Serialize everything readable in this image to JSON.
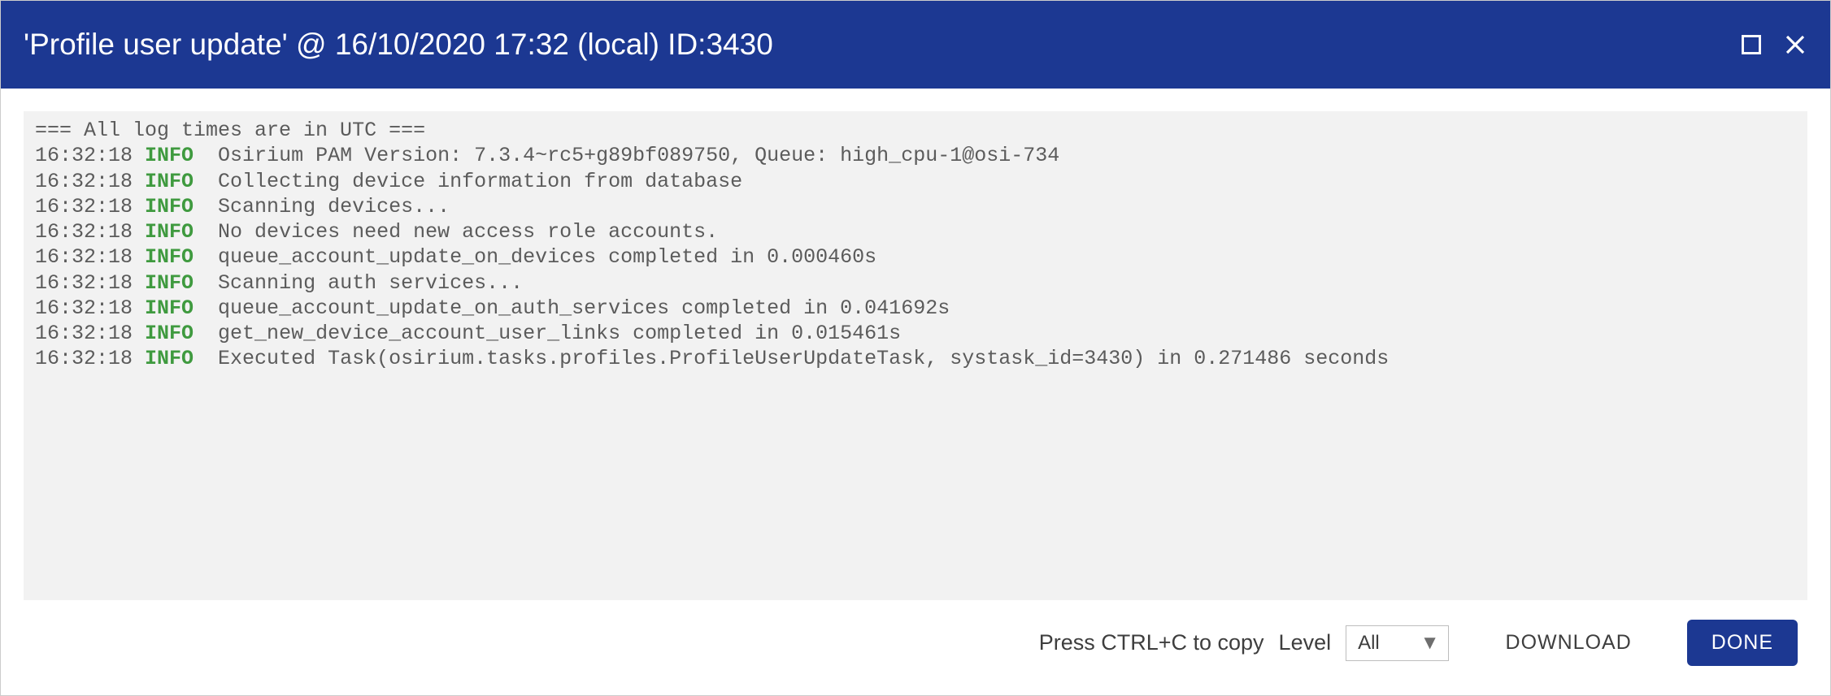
{
  "titlebar": {
    "title": "'Profile user update' @ 16/10/2020 17:32 (local) ID:3430"
  },
  "log": {
    "header": "=== All log times are in UTC ===",
    "lines": [
      {
        "time": "16:32:18",
        "level": "INFO",
        "msg": "Osirium PAM Version: 7.3.4~rc5+g89bf089750, Queue: high_cpu-1@osi-734"
      },
      {
        "time": "16:32:18",
        "level": "INFO",
        "msg": "Collecting device information from database"
      },
      {
        "time": "16:32:18",
        "level": "INFO",
        "msg": "Scanning devices..."
      },
      {
        "time": "16:32:18",
        "level": "INFO",
        "msg": "No devices need new access role accounts."
      },
      {
        "time": "16:32:18",
        "level": "INFO",
        "msg": "queue_account_update_on_devices completed in 0.000460s"
      },
      {
        "time": "16:32:18",
        "level": "INFO",
        "msg": "Scanning auth services..."
      },
      {
        "time": "16:32:18",
        "level": "INFO",
        "msg": "queue_account_update_on_auth_services completed in 0.041692s"
      },
      {
        "time": "16:32:18",
        "level": "INFO",
        "msg": "get_new_device_account_user_links completed in 0.015461s"
      },
      {
        "time": "16:32:18",
        "level": "INFO",
        "msg": "Executed Task(osirium.tasks.profiles.ProfileUserUpdateTask, systask_id=3430) in 0.271486 seconds"
      }
    ]
  },
  "footer": {
    "copy_hint": "Press CTRL+C to copy",
    "level_label": "Level",
    "level_value": "All",
    "download_label": "DOWNLOAD",
    "done_label": "DONE"
  }
}
